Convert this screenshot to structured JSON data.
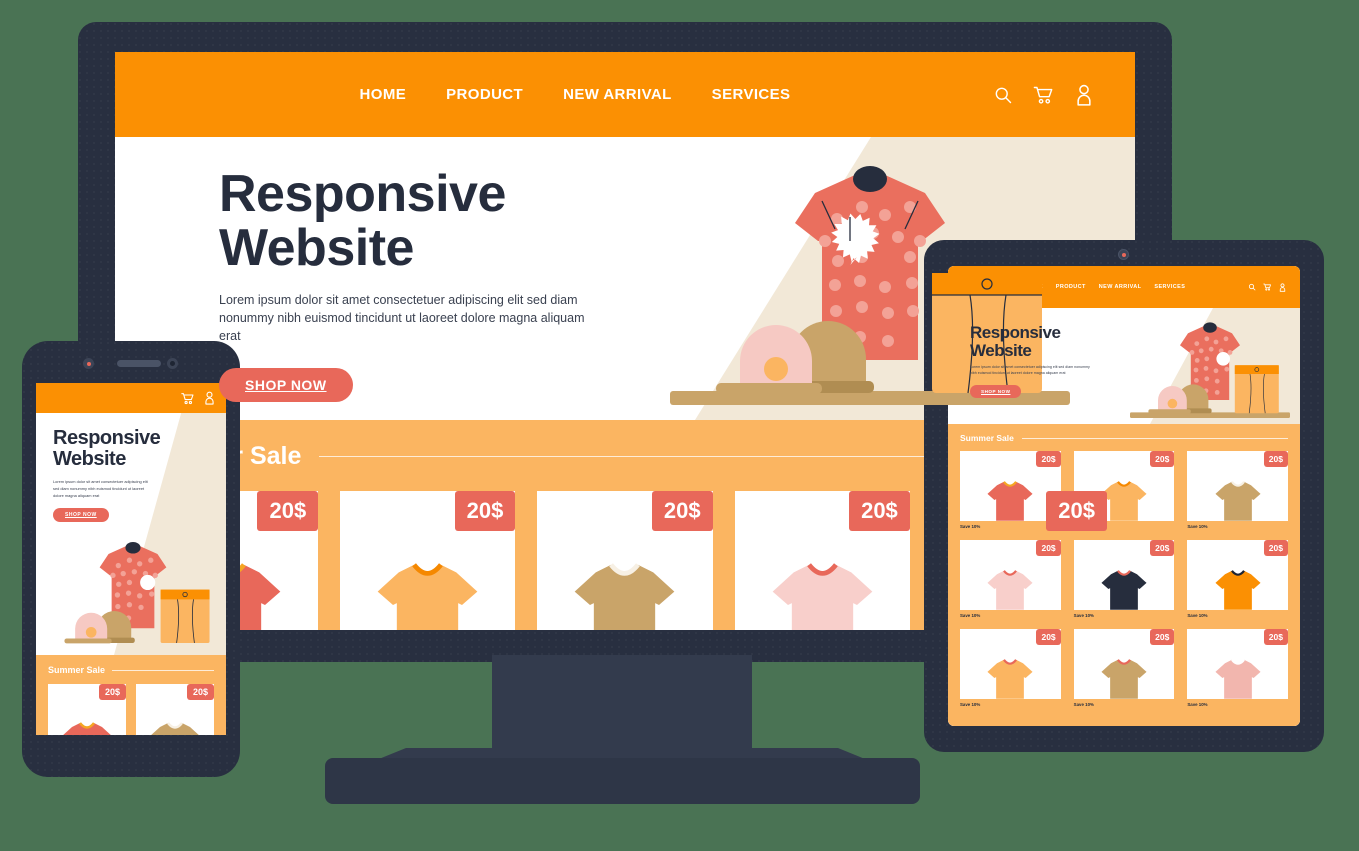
{
  "scene": {
    "background_color": "#4a7354",
    "device_frame_color": "#282f40",
    "devices": [
      "desktop-monitor",
      "tablet",
      "smartphone"
    ]
  },
  "theme": {
    "nav_orange": "#fb9003",
    "sale_orange": "#fbb561",
    "coral": "#e8685a",
    "cream": "#f2e8d7",
    "dark": "#262d3d",
    "tan": "#c9a469",
    "pink": "#f6c9c3"
  },
  "site": {
    "nav": {
      "links": [
        "HOME",
        "PRODUCT",
        "NEW ARRIVAL",
        "SERVICES"
      ],
      "icons": [
        "search-icon",
        "cart-icon",
        "user-icon"
      ]
    },
    "hero": {
      "title_line1": "Responsive",
      "title_line2": "Website",
      "body_line1": "Lorem ipsum dolor sit amet consectetuer adipiscing elit sed diam",
      "body_line2": "nonummy nibh euismod tincidunt ut laoreet dolore magna aliquam erat",
      "cta": "SHOP NOW"
    },
    "sale": {
      "title": "Summer Sale",
      "price_badge": "20$",
      "save_label": "Save 10%",
      "products": [
        {
          "color": "#e8685a",
          "collar": "#f5a623"
        },
        {
          "color": "#fbb561",
          "collar": "#f58800"
        },
        {
          "color": "#c9a469",
          "collar": "#f7f0e4"
        },
        {
          "color": "#f8cfcb",
          "collar": "#e8685a"
        },
        {
          "color": "#262d3d",
          "collar": "#e8685a"
        },
        {
          "color": "#fb9003",
          "collar": "#1d2433"
        },
        {
          "color": "#fbb561",
          "collar": "#e8685a"
        },
        {
          "color": "#c9a469",
          "collar": "#e8685a"
        },
        {
          "color": "#f2b6ae",
          "collar": "#ffffff"
        }
      ]
    }
  },
  "phone": {
    "nav_icons": [
      "cart-icon",
      "user-icon"
    ],
    "products": [
      {
        "color": "#e8685a",
        "collar": "#f5a623"
      },
      {
        "color": "#c9a469",
        "collar": "#f7f0e4"
      }
    ]
  }
}
